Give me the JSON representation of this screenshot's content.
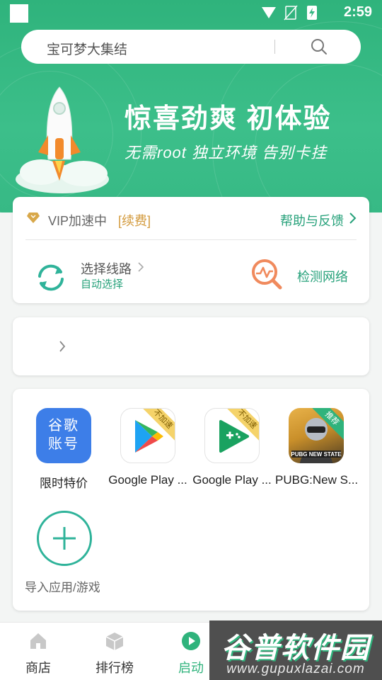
{
  "status_bar": {
    "time": "2:59"
  },
  "search": {
    "placeholder": "宝可梦大集结"
  },
  "banner": {
    "title": "惊喜劲爽 初体验",
    "subtitle": "无需root 独立环境 告别卡挂"
  },
  "vip": {
    "label": "VIP加速中",
    "renew": "[续费]",
    "help": "帮助与反馈"
  },
  "route": {
    "label": "选择线路",
    "value": "自动选择"
  },
  "network": {
    "label": "检测网络"
  },
  "apps": [
    {
      "name": "限时特价",
      "tile_text": [
        "谷歌",
        "账号"
      ],
      "badge": ""
    },
    {
      "name": "Google Play ...",
      "badge": "不加速"
    },
    {
      "name": "Google Play ...",
      "badge": "不加速"
    },
    {
      "name": "PUBG:New S...",
      "badge": "推荐"
    }
  ],
  "import_label": "导入应用/游戏",
  "tabs": [
    {
      "label": "商店",
      "icon": "home-icon"
    },
    {
      "label": "排行榜",
      "icon": "cube-icon"
    },
    {
      "label": "启动",
      "icon": "play-icon"
    },
    {
      "label": "",
      "icon": ""
    },
    {
      "label": "",
      "icon": ""
    }
  ],
  "watermark": {
    "title": "谷普软件园",
    "url": "www.gupuxlazai.com"
  },
  "colors": {
    "primary": "#2fb37c",
    "accent": "#26a17a",
    "gold": "#d39a3c",
    "tile_blue": "#3d7ee8"
  }
}
